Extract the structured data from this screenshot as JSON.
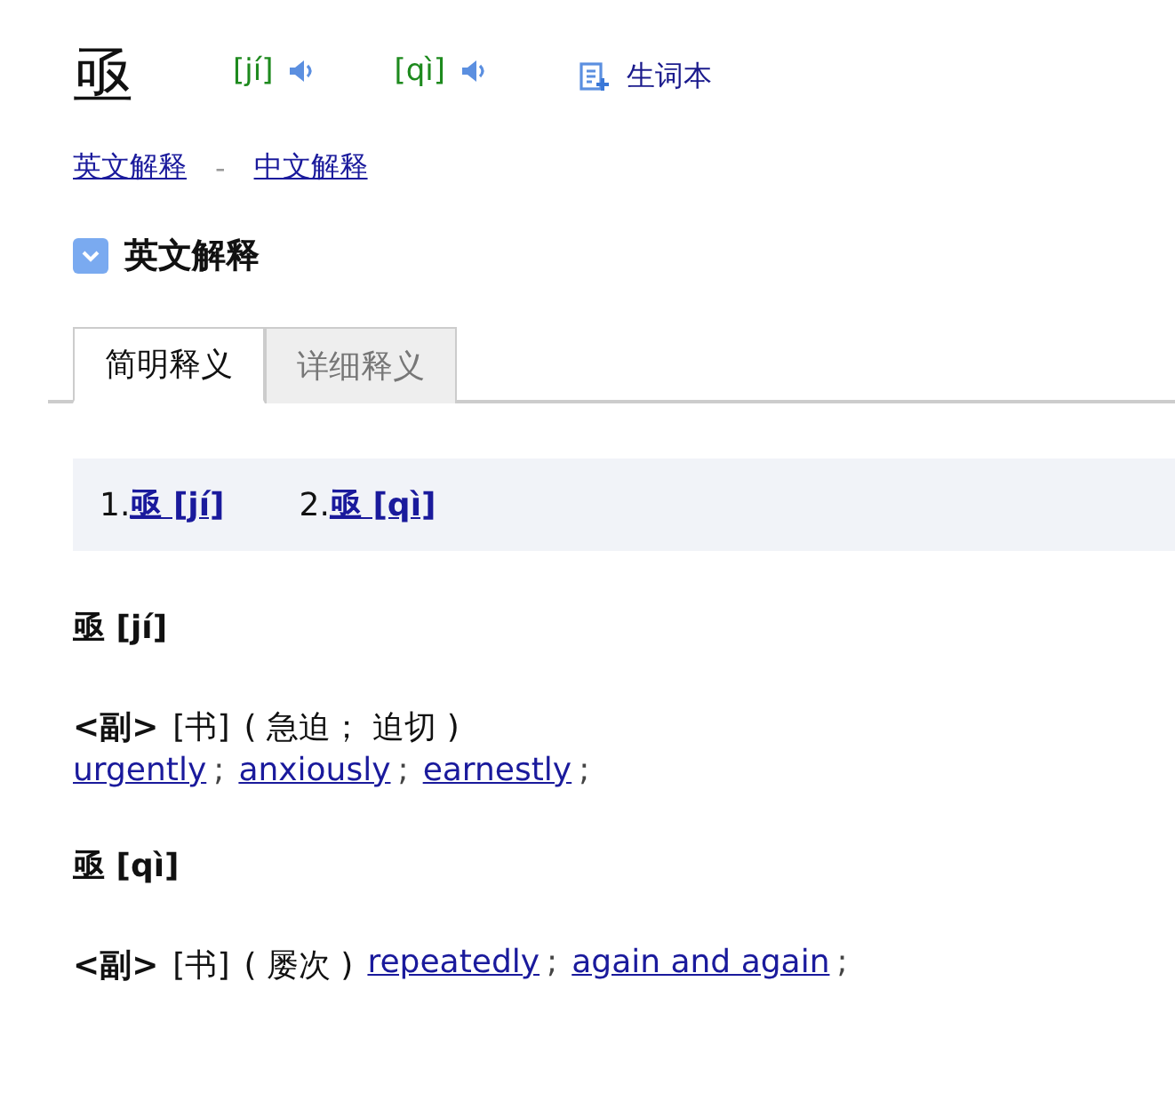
{
  "headword": "亟",
  "pronunciations": [
    {
      "text": "[jí]"
    },
    {
      "text": "[qì]"
    }
  ],
  "wordbook": "生词本",
  "nav_links": [
    {
      "label": "英文解释"
    },
    {
      "label": "中文解释"
    }
  ],
  "nav_separator": "-",
  "section": {
    "title": "英文解释",
    "expanded": true
  },
  "tabs": [
    {
      "label": "简明释义",
      "selected": true
    },
    {
      "label": "详细释义",
      "selected": false
    }
  ],
  "sense_index": [
    {
      "number": "1.",
      "link": "亟 [jí]"
    },
    {
      "number": "2.",
      "link": "亟 [qì]"
    }
  ],
  "entries": [
    {
      "heading": "亟 [jí]",
      "pos": "<副>",
      "register": "[书]",
      "gloss": "( 急迫； 迫切 )",
      "kind": "block",
      "translations": [
        "urgently",
        "anxiously",
        "earnestly"
      ]
    },
    {
      "heading": "亟 [qì]",
      "pos": "<副>",
      "register": "[书]",
      "gloss": "( 屡次 )",
      "kind": "inline",
      "translations": [
        "repeatedly",
        "again and again"
      ]
    }
  ],
  "translation_separator": ";"
}
